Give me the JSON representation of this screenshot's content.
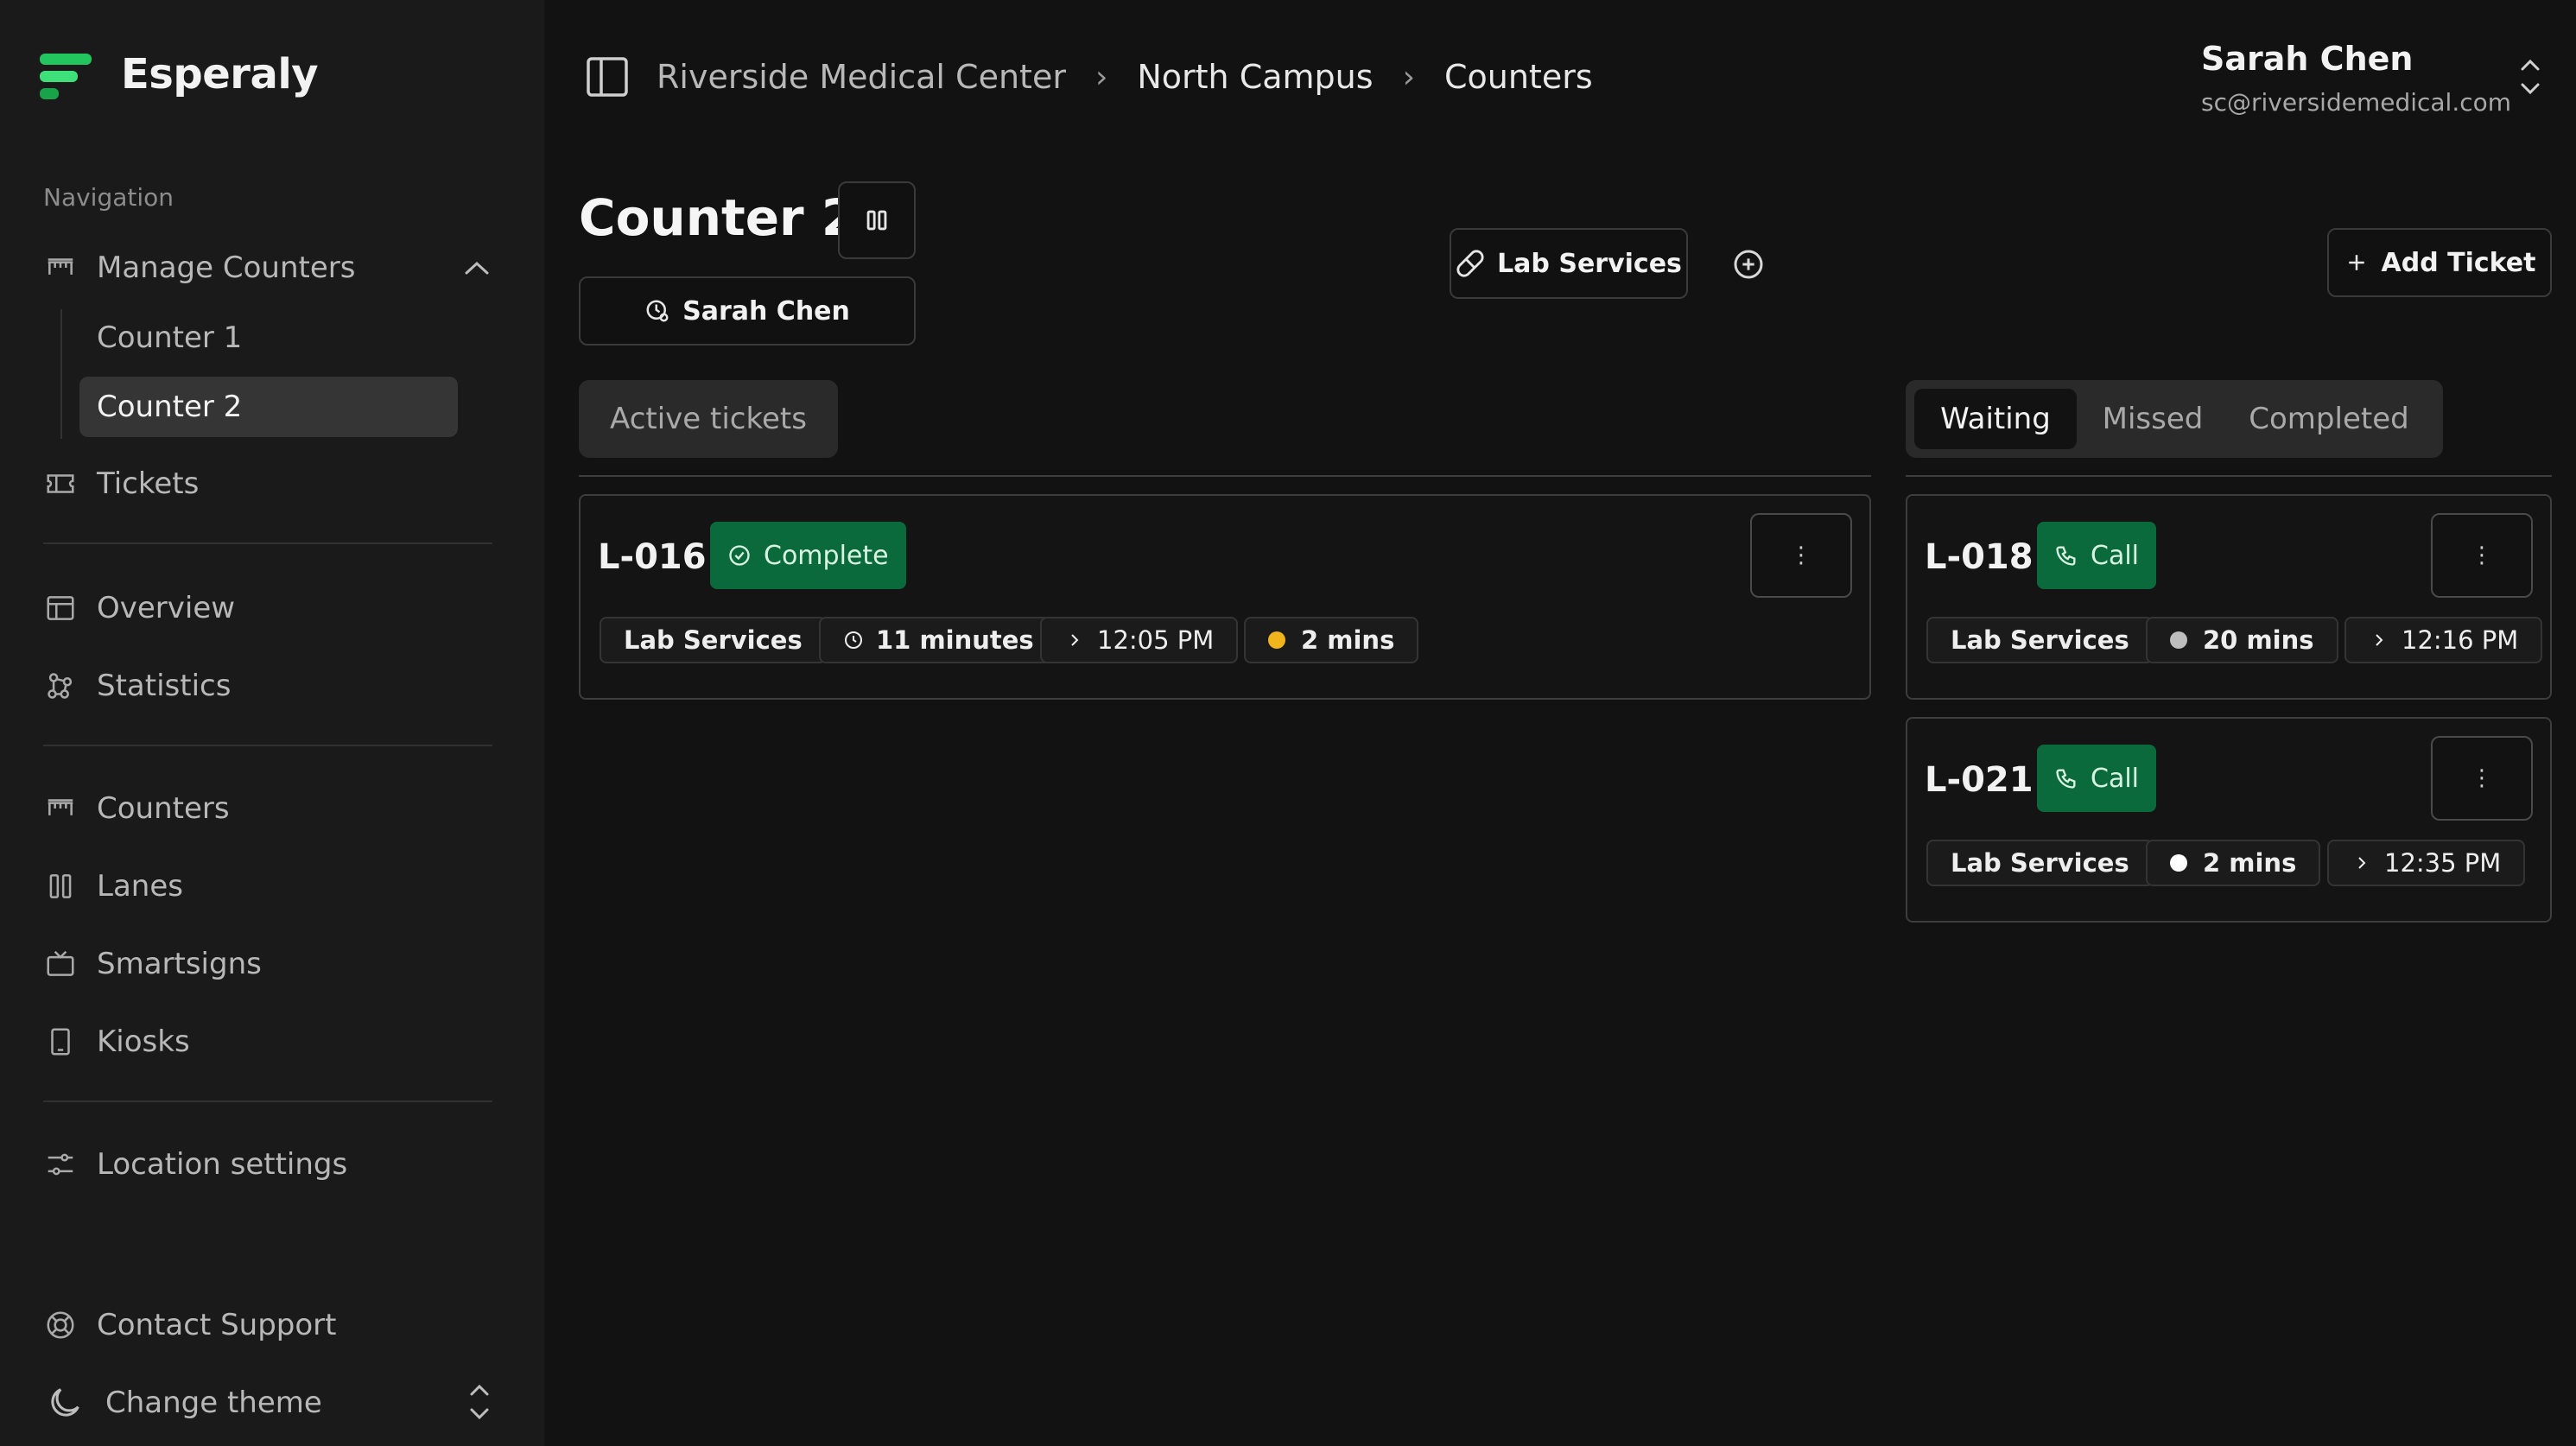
{
  "app": {
    "name": "Esperaly"
  },
  "sidebar": {
    "heading": "Navigation",
    "manage": {
      "label": "Manage Counters",
      "items": [
        {
          "label": "Counter 1"
        },
        {
          "label": "Counter 2"
        }
      ]
    },
    "tickets": "Tickets",
    "overview": "Overview",
    "statistics": "Statistics",
    "counters": "Counters",
    "lanes": "Lanes",
    "smartsigns": "Smartsigns",
    "kiosks": "Kiosks",
    "location_settings": "Location settings",
    "contact_support": "Contact Support",
    "change_theme": "Change theme"
  },
  "breadcrumb": {
    "items": [
      "Riverside Medical Center",
      "North Campus",
      "Counters"
    ]
  },
  "user": {
    "name": "Sarah Chen",
    "email": "sc@riversidemedical.com"
  },
  "counter": {
    "title": "Counter 2",
    "assignee": "Sarah Chen",
    "service": "Lab Services",
    "add_ticket": "Add Ticket"
  },
  "tabs": {
    "active_tickets": "Active tickets",
    "queue": [
      "Waiting",
      "Missed",
      "Completed"
    ],
    "selected": "Waiting"
  },
  "active_tickets": [
    {
      "id": "L-016",
      "action": "Complete",
      "service": "Lab Services",
      "duration": "11 minutes",
      "time": "12:05 PM",
      "wait": "2 mins",
      "wait_color": "#f0b41c"
    }
  ],
  "waiting_tickets": [
    {
      "id": "L-018",
      "action": "Call",
      "service": "Lab Services",
      "wait": "20 mins",
      "time": "12:16 PM",
      "dot_color": "#bdbdbd"
    },
    {
      "id": "L-021",
      "action": "Call",
      "service": "Lab Services",
      "wait": "2 mins",
      "time": "12:35 PM",
      "dot_color": "#ffffff"
    }
  ],
  "colors": {
    "accent": "#0b6a3c",
    "logo": "#22c55e"
  }
}
